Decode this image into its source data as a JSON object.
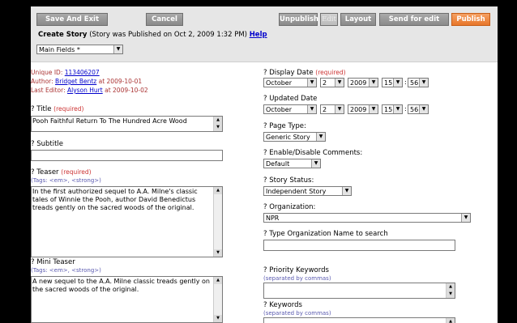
{
  "toolbar": {
    "save_exit": "Save And Exit",
    "cancel": "Cancel",
    "unpublish": "Unpublish",
    "edit": "Edit",
    "layout": "Layout",
    "send_for_edit": "Send for edit",
    "publish": "Publish"
  },
  "header": {
    "title": "Create Story",
    "status": "(Story was Published on Oct 2, 2009 1:32 PM)",
    "help": "Help"
  },
  "field_group": {
    "value": "Main Fields *"
  },
  "meta": {
    "unique_id_label": "Unique ID:",
    "unique_id": "113406207",
    "author_label": "Author:",
    "author": "Bridget Bentz",
    "author_date": "at 2009-10-01",
    "editor_label": "Last Editor:",
    "editor": "Alyson Hurt",
    "editor_date": "at 2009-10-02"
  },
  "left": {
    "title_label": "? Title",
    "title_req": "(required)",
    "title_value": "Pooh Faithful Return To The Hundred Acre Wood",
    "subtitle_label": "? Subtitle",
    "subtitle_value": "",
    "teaser_label": "? Teaser",
    "teaser_req": "(required)",
    "teaser_tags": "(Tags: <em>, <strong>)",
    "teaser_value": "In the first authorized sequel to A.A. Milne's classic tales of Winnie the Pooh, author David Benedictus treads gently on the sacred woods of the original.",
    "mini_label": "? Mini Teaser",
    "mini_tags": "(Tags: <em>, <strong>)",
    "mini_value": "A new sequel to the A.A. Milne classic treads gently on the sacred woods of the original."
  },
  "right": {
    "display_date_label": "? Display Date",
    "display_date_req": "(required)",
    "display_date": {
      "month": "October",
      "day": "2",
      "year": "2009",
      "hour": "15",
      "minute": "56"
    },
    "updated_date_label": "? Updated Date",
    "updated_date": {
      "month": "October",
      "day": "2",
      "year": "2009",
      "hour": "15",
      "minute": "56"
    },
    "colon": ":",
    "page_type_label": "? Page Type:",
    "page_type": "Generic Story",
    "comments_label": "? Enable/Disable Comments:",
    "comments": "Default",
    "status_label": "? Story Status:",
    "status": "Independent Story",
    "org_label": "? Organization:",
    "org": "NPR",
    "org_search_label": "? Type Organization Name to search",
    "org_search_value": "",
    "priority_label": "? Priority Keywords",
    "priority_hint": "(separated by commas)",
    "keywords_label": "? Keywords",
    "keywords_hint": "(separated by commas)"
  },
  "colors": {
    "publish": "#e8762a",
    "link": "#0000cc",
    "required": "#cc3333",
    "hint": "#5a5ab0"
  }
}
